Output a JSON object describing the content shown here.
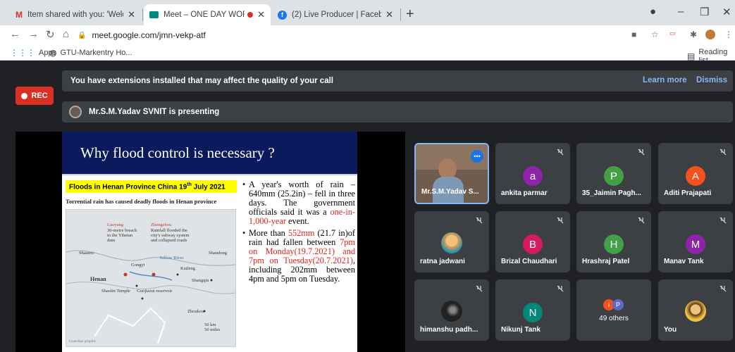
{
  "tabs": [
    {
      "title": "Item shared with you: 'Welcome",
      "icon": "gmail-icon",
      "icon_color": "#d93025"
    },
    {
      "title": "Meet – ONE DAY WORKSHO",
      "icon": "meet-icon",
      "icon_color": "#00897b",
      "active": true
    },
    {
      "title": "(2) Live Producer | Facebook",
      "icon": "facebook-icon",
      "icon_color": "#1877f2"
    }
  ],
  "address": {
    "url": "meet.google.com/jmn-vekp-atf"
  },
  "bookmarks": {
    "apps": "Apps",
    "gtu": "GTU-Markentry Ho...",
    "reading_list": "Reading list"
  },
  "banner": {
    "message": "You have extensions installed that may affect the quality of your call",
    "learn_more": "Learn more",
    "dismiss": "Dismiss"
  },
  "rec_label": "REC",
  "presenting": "Mr.S.M.Yadav SVNIT is presenting",
  "slide": {
    "title": "Why flood control is necessary ?",
    "caption_main": "Floods in Henan Province China 19",
    "caption_sup": "th",
    "caption_end": " July 2021",
    "map_title": "Torrential rain has caused deadly floods in Henan province",
    "map_labels": {
      "luoyang": "Luoyang",
      "luoyang_desc": "30-metre breach in the Yihetan dam",
      "zhengzhou": "Zhengzhou",
      "zhengzhou_desc": "Rainfall flooded the city's subway system and collapsed roads",
      "shaanxi": "Shaanxi",
      "shandong": "Shandong",
      "yellow_river": "Yellow River",
      "kaifeng": "Kaifeng",
      "gongyi": "Gongyi",
      "henan": "Henan",
      "shangqiu": "Shangqiu",
      "temple": "Shaolin Temple",
      "guojiaxu": "Guojiazui reservoir",
      "zhoukou": "Zhoukou",
      "scale_km": "50 km",
      "scale_mi": "50 miles",
      "credit": "Guardian graphic"
    },
    "b1_a": "A year's worth of rain – 640mm (25.2in) – fell in three days. The government officials said it was a ",
    "b1_hl": "one-in-1,000-year",
    "b1_b": " event.",
    "b2_a": "More than ",
    "b2_hl1": "552mm",
    "b2_b": " (21.7 in)of rain had fallen between ",
    "b2_hl2": "7pm on Monday(19.7.2021) and 7pm on Tuesday(20.7.2021)",
    "b2_c": ", including 202mm between 4pm and 5pm on Tuesday."
  },
  "participants": [
    {
      "name": "Mr.S.M.Yadav S...",
      "type": "video"
    },
    {
      "name": "ankita parmar",
      "initial": "a",
      "color": "#8e24aa"
    },
    {
      "name": "35_Jaimin Pagh...",
      "initial": "P",
      "color": "#43a047"
    },
    {
      "name": "Aditi Prajapati",
      "initial": "A",
      "color": "#f4511e"
    },
    {
      "name": "ratna jadwani",
      "type": "photo",
      "color": "#e6a04c"
    },
    {
      "name": "Brizal Chaudhari",
      "initial": "B",
      "color": "#d81b60"
    },
    {
      "name": "Hrashraj Patel",
      "initial": "H",
      "color": "#43a047"
    },
    {
      "name": "Manav Tank",
      "initial": "M",
      "color": "#8e24aa"
    },
    {
      "name": "himanshu padh...",
      "type": "photo",
      "color": "#222222"
    },
    {
      "name": "Nikunj Tank",
      "initial": "N",
      "color": "#00897b"
    },
    {
      "name": "49 others",
      "type": "others",
      "initials": [
        "I",
        "P"
      ],
      "colors": [
        "#f4511e",
        "#5c6bc0"
      ]
    },
    {
      "name": "You",
      "type": "photo",
      "color": "#f0c040"
    }
  ]
}
